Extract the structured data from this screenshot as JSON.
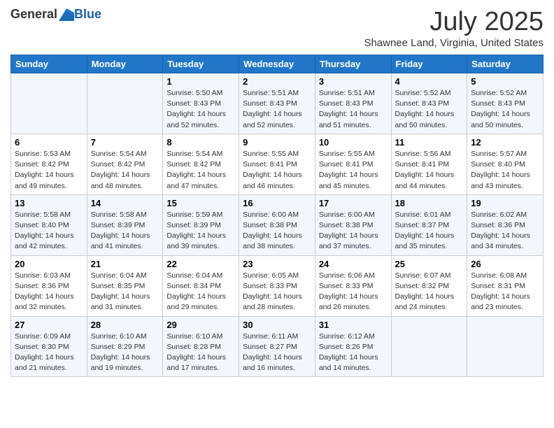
{
  "header": {
    "logo_general": "General",
    "logo_blue": "Blue",
    "month_title": "July 2025",
    "subtitle": "Shawnee Land, Virginia, United States"
  },
  "days_of_week": [
    "Sunday",
    "Monday",
    "Tuesday",
    "Wednesday",
    "Thursday",
    "Friday",
    "Saturday"
  ],
  "weeks": [
    [
      {
        "day": "",
        "sunrise": "",
        "sunset": "",
        "daylight": ""
      },
      {
        "day": "",
        "sunrise": "",
        "sunset": "",
        "daylight": ""
      },
      {
        "day": "1",
        "sunrise": "Sunrise: 5:50 AM",
        "sunset": "Sunset: 8:43 PM",
        "daylight": "Daylight: 14 hours and 52 minutes."
      },
      {
        "day": "2",
        "sunrise": "Sunrise: 5:51 AM",
        "sunset": "Sunset: 8:43 PM",
        "daylight": "Daylight: 14 hours and 52 minutes."
      },
      {
        "day": "3",
        "sunrise": "Sunrise: 5:51 AM",
        "sunset": "Sunset: 8:43 PM",
        "daylight": "Daylight: 14 hours and 51 minutes."
      },
      {
        "day": "4",
        "sunrise": "Sunrise: 5:52 AM",
        "sunset": "Sunset: 8:43 PM",
        "daylight": "Daylight: 14 hours and 50 minutes."
      },
      {
        "day": "5",
        "sunrise": "Sunrise: 5:52 AM",
        "sunset": "Sunset: 8:43 PM",
        "daylight": "Daylight: 14 hours and 50 minutes."
      }
    ],
    [
      {
        "day": "6",
        "sunrise": "Sunrise: 5:53 AM",
        "sunset": "Sunset: 8:42 PM",
        "daylight": "Daylight: 14 hours and 49 minutes."
      },
      {
        "day": "7",
        "sunrise": "Sunrise: 5:54 AM",
        "sunset": "Sunset: 8:42 PM",
        "daylight": "Daylight: 14 hours and 48 minutes."
      },
      {
        "day": "8",
        "sunrise": "Sunrise: 5:54 AM",
        "sunset": "Sunset: 8:42 PM",
        "daylight": "Daylight: 14 hours and 47 minutes."
      },
      {
        "day": "9",
        "sunrise": "Sunrise: 5:55 AM",
        "sunset": "Sunset: 8:41 PM",
        "daylight": "Daylight: 14 hours and 46 minutes."
      },
      {
        "day": "10",
        "sunrise": "Sunrise: 5:55 AM",
        "sunset": "Sunset: 8:41 PM",
        "daylight": "Daylight: 14 hours and 45 minutes."
      },
      {
        "day": "11",
        "sunrise": "Sunrise: 5:56 AM",
        "sunset": "Sunset: 8:41 PM",
        "daylight": "Daylight: 14 hours and 44 minutes."
      },
      {
        "day": "12",
        "sunrise": "Sunrise: 5:57 AM",
        "sunset": "Sunset: 8:40 PM",
        "daylight": "Daylight: 14 hours and 43 minutes."
      }
    ],
    [
      {
        "day": "13",
        "sunrise": "Sunrise: 5:58 AM",
        "sunset": "Sunset: 8:40 PM",
        "daylight": "Daylight: 14 hours and 42 minutes."
      },
      {
        "day": "14",
        "sunrise": "Sunrise: 5:58 AM",
        "sunset": "Sunset: 8:39 PM",
        "daylight": "Daylight: 14 hours and 41 minutes."
      },
      {
        "day": "15",
        "sunrise": "Sunrise: 5:59 AM",
        "sunset": "Sunset: 8:39 PM",
        "daylight": "Daylight: 14 hours and 39 minutes."
      },
      {
        "day": "16",
        "sunrise": "Sunrise: 6:00 AM",
        "sunset": "Sunset: 8:38 PM",
        "daylight": "Daylight: 14 hours and 38 minutes."
      },
      {
        "day": "17",
        "sunrise": "Sunrise: 6:00 AM",
        "sunset": "Sunset: 8:38 PM",
        "daylight": "Daylight: 14 hours and 37 minutes."
      },
      {
        "day": "18",
        "sunrise": "Sunrise: 6:01 AM",
        "sunset": "Sunset: 8:37 PM",
        "daylight": "Daylight: 14 hours and 35 minutes."
      },
      {
        "day": "19",
        "sunrise": "Sunrise: 6:02 AM",
        "sunset": "Sunset: 8:36 PM",
        "daylight": "Daylight: 14 hours and 34 minutes."
      }
    ],
    [
      {
        "day": "20",
        "sunrise": "Sunrise: 6:03 AM",
        "sunset": "Sunset: 8:36 PM",
        "daylight": "Daylight: 14 hours and 32 minutes."
      },
      {
        "day": "21",
        "sunrise": "Sunrise: 6:04 AM",
        "sunset": "Sunset: 8:35 PM",
        "daylight": "Daylight: 14 hours and 31 minutes."
      },
      {
        "day": "22",
        "sunrise": "Sunrise: 6:04 AM",
        "sunset": "Sunset: 8:34 PM",
        "daylight": "Daylight: 14 hours and 29 minutes."
      },
      {
        "day": "23",
        "sunrise": "Sunrise: 6:05 AM",
        "sunset": "Sunset: 8:33 PM",
        "daylight": "Daylight: 14 hours and 28 minutes."
      },
      {
        "day": "24",
        "sunrise": "Sunrise: 6:06 AM",
        "sunset": "Sunset: 8:33 PM",
        "daylight": "Daylight: 14 hours and 26 minutes."
      },
      {
        "day": "25",
        "sunrise": "Sunrise: 6:07 AM",
        "sunset": "Sunset: 8:32 PM",
        "daylight": "Daylight: 14 hours and 24 minutes."
      },
      {
        "day": "26",
        "sunrise": "Sunrise: 6:08 AM",
        "sunset": "Sunset: 8:31 PM",
        "daylight": "Daylight: 14 hours and 23 minutes."
      }
    ],
    [
      {
        "day": "27",
        "sunrise": "Sunrise: 6:09 AM",
        "sunset": "Sunset: 8:30 PM",
        "daylight": "Daylight: 14 hours and 21 minutes."
      },
      {
        "day": "28",
        "sunrise": "Sunrise: 6:10 AM",
        "sunset": "Sunset: 8:29 PM",
        "daylight": "Daylight: 14 hours and 19 minutes."
      },
      {
        "day": "29",
        "sunrise": "Sunrise: 6:10 AM",
        "sunset": "Sunset: 8:28 PM",
        "daylight": "Daylight: 14 hours and 17 minutes."
      },
      {
        "day": "30",
        "sunrise": "Sunrise: 6:11 AM",
        "sunset": "Sunset: 8:27 PM",
        "daylight": "Daylight: 14 hours and 16 minutes."
      },
      {
        "day": "31",
        "sunrise": "Sunrise: 6:12 AM",
        "sunset": "Sunset: 8:26 PM",
        "daylight": "Daylight: 14 hours and 14 minutes."
      },
      {
        "day": "",
        "sunrise": "",
        "sunset": "",
        "daylight": ""
      },
      {
        "day": "",
        "sunrise": "",
        "sunset": "",
        "daylight": ""
      }
    ]
  ]
}
